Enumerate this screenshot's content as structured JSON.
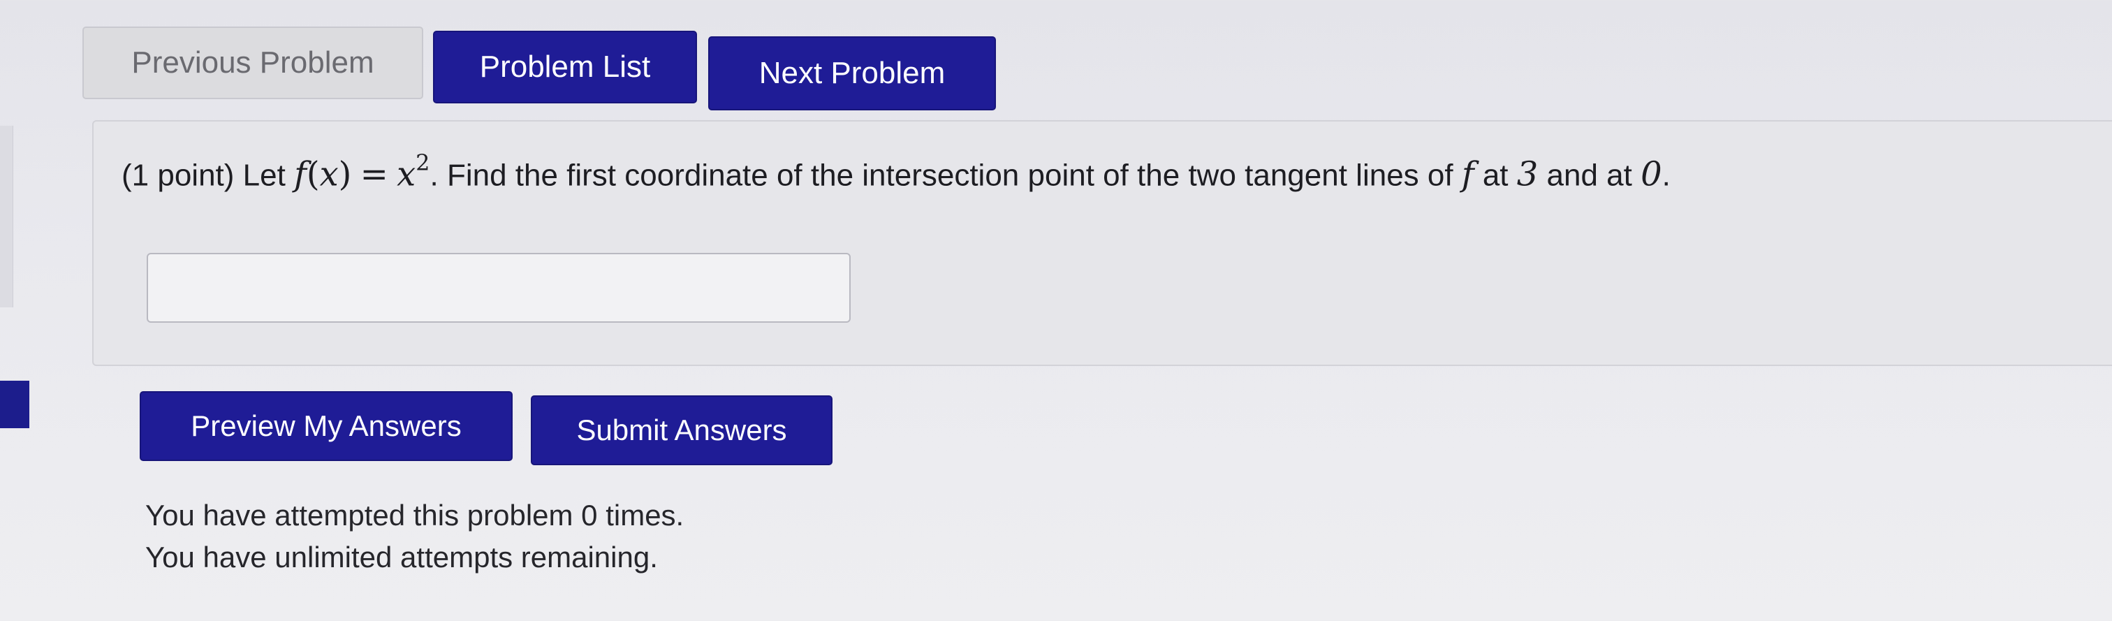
{
  "nav": {
    "previous_label": "Previous Problem",
    "list_label": "Problem List",
    "next_label": "Next Problem"
  },
  "problem": {
    "points": "(1 point)",
    "text_let": "Let",
    "func_name": "f",
    "func_arg": "x",
    "equals": "=",
    "expr_var": "x",
    "expr_exp": "2",
    "text_find": ". Find the first coordinate of the intersection point of the two tangent lines of",
    "func_ref": "f",
    "text_at": "at",
    "point_a": "3",
    "text_and_at": "and at",
    "point_b": "0",
    "period": "."
  },
  "answer": {
    "value": "",
    "placeholder": ""
  },
  "actions": {
    "preview_label": "Preview My Answers",
    "submit_label": "Submit Answers"
  },
  "status": {
    "attempts_line": "You have attempted this problem 0 times.",
    "remaining_line": "You have unlimited attempts remaining."
  },
  "colors": {
    "primary_button": "#1f1c96",
    "disabled_button": "#dcdcdf",
    "panel_background": "#e6e6ea"
  }
}
